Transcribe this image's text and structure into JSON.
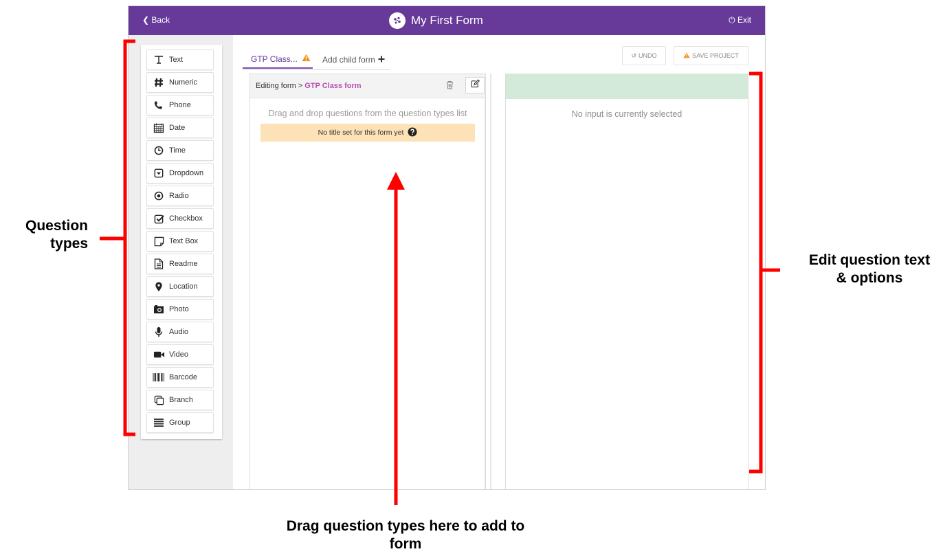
{
  "header": {
    "back_label": "Back",
    "title": "My First Form",
    "exit_label": "Exit",
    "bar_color": "#673a9a"
  },
  "question_types": [
    {
      "label": "Text",
      "icon": "text-icon"
    },
    {
      "label": "Numeric",
      "icon": "hash-icon"
    },
    {
      "label": "Phone",
      "icon": "phone-icon"
    },
    {
      "label": "Date",
      "icon": "calendar-icon"
    },
    {
      "label": "Time",
      "icon": "clock-icon"
    },
    {
      "label": "Dropdown",
      "icon": "dropdown-icon"
    },
    {
      "label": "Radio",
      "icon": "radio-icon"
    },
    {
      "label": "Checkbox",
      "icon": "checkbox-icon"
    },
    {
      "label": "Text Box",
      "icon": "textbox-icon"
    },
    {
      "label": "Readme",
      "icon": "document-icon"
    },
    {
      "label": "Location",
      "icon": "map-pin-icon"
    },
    {
      "label": "Photo",
      "icon": "camera-icon"
    },
    {
      "label": "Audio",
      "icon": "microphone-icon"
    },
    {
      "label": "Video",
      "icon": "video-camera-icon"
    },
    {
      "label": "Barcode",
      "icon": "barcode-icon"
    },
    {
      "label": "Branch",
      "icon": "branch-icon"
    },
    {
      "label": "Group",
      "icon": "group-lines-icon"
    }
  ],
  "tabs": {
    "current": "GTP Class...",
    "add_child": "Add child form"
  },
  "toolbar": {
    "undo_label": "UNDO",
    "save_label": "SAVE PROJECT"
  },
  "form_panel": {
    "breadcrumb_prefix": "Editing form > ",
    "form_name": "GTP Class form",
    "drop_hint": "Drag and drop questions from the question types list",
    "no_title_warning": "No title set for this form yet"
  },
  "edit_panel": {
    "empty_message": "No input is currently selected",
    "header_color": "#d3eadb"
  },
  "annotations": {
    "question_types": "Question types",
    "edit_question": "Edit question text & options",
    "drag_here": "Drag question types here to add to form",
    "color": "#ff0000"
  }
}
